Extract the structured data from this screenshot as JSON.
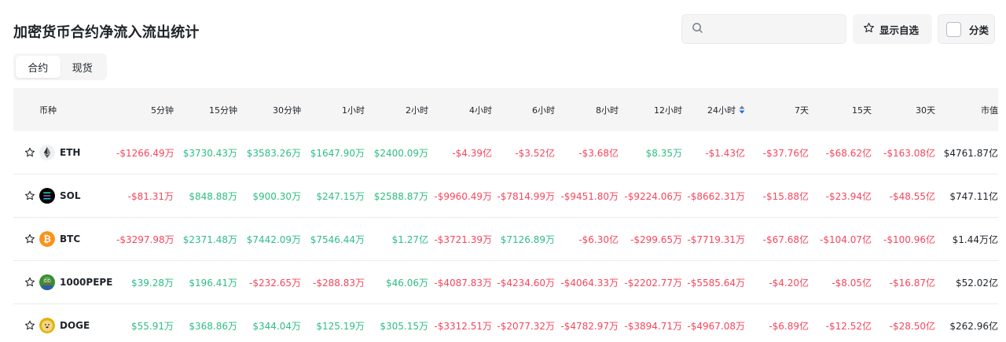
{
  "page": {
    "title": "加密货币合约净流入流出统计"
  },
  "toolbar": {
    "search_placeholder": "",
    "watchlist_label": "显示自选",
    "category_label": "分类"
  },
  "tabs": [
    {
      "label": "合约",
      "active": true
    },
    {
      "label": "现货",
      "active": false
    }
  ],
  "colors": {
    "positive": "#2ebd85",
    "negative": "#f6465d"
  },
  "table": {
    "columns": [
      "币种",
      "5分钟",
      "15分钟",
      "30分钟",
      "1小时",
      "2小时",
      "4小时",
      "6小时",
      "8小时",
      "12小时",
      "24小时",
      "7天",
      "15天",
      "30天",
      "市值"
    ],
    "sorted_column": "24小时",
    "rows": [
      {
        "symbol": "ETH",
        "icon": "eth-icon",
        "values": [
          "-$1266.49万",
          "$3730.43万",
          "$3583.26万",
          "$1647.90万",
          "$2400.09万",
          "-$4.39亿",
          "-$3.52亿",
          "-$3.68亿",
          "$8.35万",
          "-$1.43亿",
          "-$37.76亿",
          "-$68.62亿",
          "-$163.08亿"
        ],
        "market_cap": "$4761.87亿"
      },
      {
        "symbol": "SOL",
        "icon": "sol-icon",
        "values": [
          "-$81.31万",
          "$848.88万",
          "$900.30万",
          "$247.15万",
          "$2588.87万",
          "-$9960.49万",
          "-$7814.99万",
          "-$9451.80万",
          "-$9224.06万",
          "-$8662.31万",
          "-$15.88亿",
          "-$23.94亿",
          "-$48.55亿"
        ],
        "market_cap": "$747.11亿"
      },
      {
        "symbol": "BTC",
        "icon": "btc-icon",
        "values": [
          "-$3297.98万",
          "$2371.48万",
          "$7442.09万",
          "$7546.44万",
          "$1.27亿",
          "-$3721.39万",
          "$7126.89万",
          "-$6.30亿",
          "-$299.65万",
          "-$7719.31万",
          "-$67.68亿",
          "-$104.07亿",
          "-$100.96亿"
        ],
        "market_cap": "$1.44万亿"
      },
      {
        "symbol": "1000PEPE",
        "icon": "pepe-icon",
        "values": [
          "$39.28万",
          "$196.41万",
          "-$232.65万",
          "-$288.83万",
          "$46.06万",
          "-$4087.83万",
          "-$4234.60万",
          "-$4064.33万",
          "-$2202.77万",
          "-$5585.64万",
          "-$4.20亿",
          "-$8.05亿",
          "-$16.87亿"
        ],
        "market_cap": "$52.02亿"
      },
      {
        "symbol": "DOGE",
        "icon": "doge-icon",
        "values": [
          "$55.91万",
          "$368.86万",
          "$344.04万",
          "$125.19万",
          "$305.15万",
          "-$3312.51万",
          "-$2077.32万",
          "-$4782.97万",
          "-$3894.71万",
          "-$4967.08万",
          "-$6.89亿",
          "-$12.52亿",
          "-$28.50亿"
        ],
        "market_cap": "$262.96亿"
      }
    ]
  }
}
